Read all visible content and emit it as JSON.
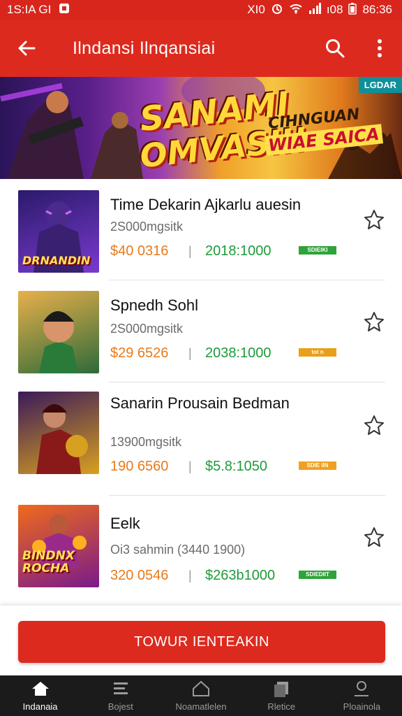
{
  "status_bar": {
    "time": "1S:IA GI",
    "right_text": "XI0",
    "battery": "ı08",
    "clock": "86:36"
  },
  "app_bar": {
    "title": "Ilndansi Ilnqansiai"
  },
  "banner": {
    "headline_1": "SANAMI",
    "headline_2": "OMVASII!",
    "sub_1": "CIHNGUAN",
    "sub_2": "WIAE SAICA",
    "tag": "LGDAR"
  },
  "items": [
    {
      "name": "Time Dekarin Ajkarlu auesin",
      "meta": "2S000mgsitk",
      "price": "$40 0316",
      "separator": "|",
      "count": "2018:1000",
      "badge": "SDIEIKI",
      "badge_color": "#2fa33a",
      "thumb_caption": "DRNANDIN",
      "thumb_colors": [
        "#2a1a6a",
        "#7a3ad0"
      ]
    },
    {
      "name": "Spnedh Sohl",
      "meta": "2S000mgsitk",
      "price": "$29 6526",
      "separator": "|",
      "count": "2038:1000",
      "badge": "tot n",
      "badge_color": "#e8a01a",
      "thumb_caption": "",
      "thumb_colors": [
        "#e8b04a",
        "#2e6a3a"
      ]
    },
    {
      "name": "Sanarin Prousain Bedman",
      "meta": "13900mgsitk",
      "price": "190 6560",
      "separator": "|",
      "count": "$5.8:1050",
      "badge": "SDIE IIN",
      "badge_color": "#f0a020",
      "thumb_caption": "",
      "thumb_colors": [
        "#3a1a5a",
        "#d8a020"
      ]
    },
    {
      "name": "Eelk",
      "meta": "Oi3 sahmin (3440 1900)",
      "price": "320 0546",
      "separator": "|",
      "count": "$263b1000",
      "badge": "SDIEDIIT",
      "badge_color": "#2fa33a",
      "thumb_caption": "BINDNX ROCHA",
      "thumb_colors": [
        "#f06a1a",
        "#7a1a8a"
      ]
    }
  ],
  "cta": {
    "label": "TOWUR IENTEAKIN"
  },
  "bottom_nav": [
    {
      "label": "Indanaia",
      "icon": "home-icon",
      "active": true
    },
    {
      "label": "Bojest",
      "icon": "list-icon",
      "active": false
    },
    {
      "label": "Noamatlelen",
      "icon": "bookmark-icon",
      "active": false
    },
    {
      "label": "Rletice",
      "icon": "cards-icon",
      "active": false
    },
    {
      "label": "Ploainola",
      "icon": "profile-icon",
      "active": false
    }
  ]
}
